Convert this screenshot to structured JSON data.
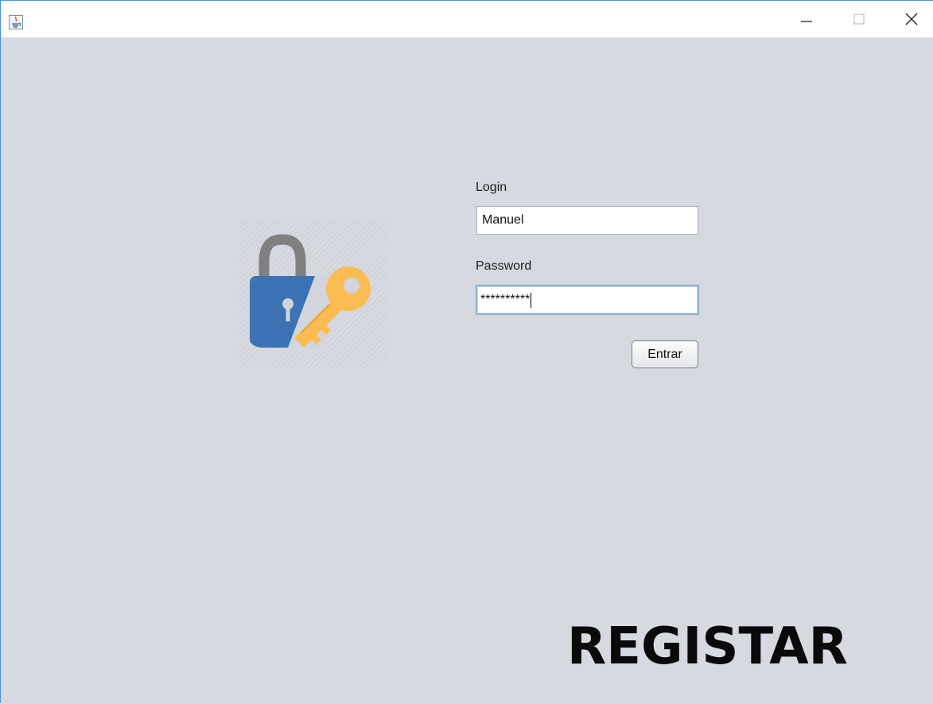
{
  "window": {
    "controls": {
      "minimize": "minimize-icon",
      "maximize": "maximize-icon",
      "close": "close-icon"
    },
    "app_icon": "java-icon"
  },
  "login_form": {
    "login_label": "Login",
    "login_value": "Manuel",
    "password_label": "Password",
    "password_value": "**********",
    "submit_label": "Entrar"
  },
  "register": {
    "label": "REGISTAR"
  },
  "logo": {
    "icon": "padlock-key-icon",
    "colors": {
      "shackle": "#808080",
      "lock_body": "#3b73b4",
      "key": "#fbbd52"
    }
  },
  "colors": {
    "background": "#d6d9e0",
    "titlebar": "#ffffff",
    "window_border": "#4a8fd6",
    "focus_border": "#8fb0d2"
  }
}
